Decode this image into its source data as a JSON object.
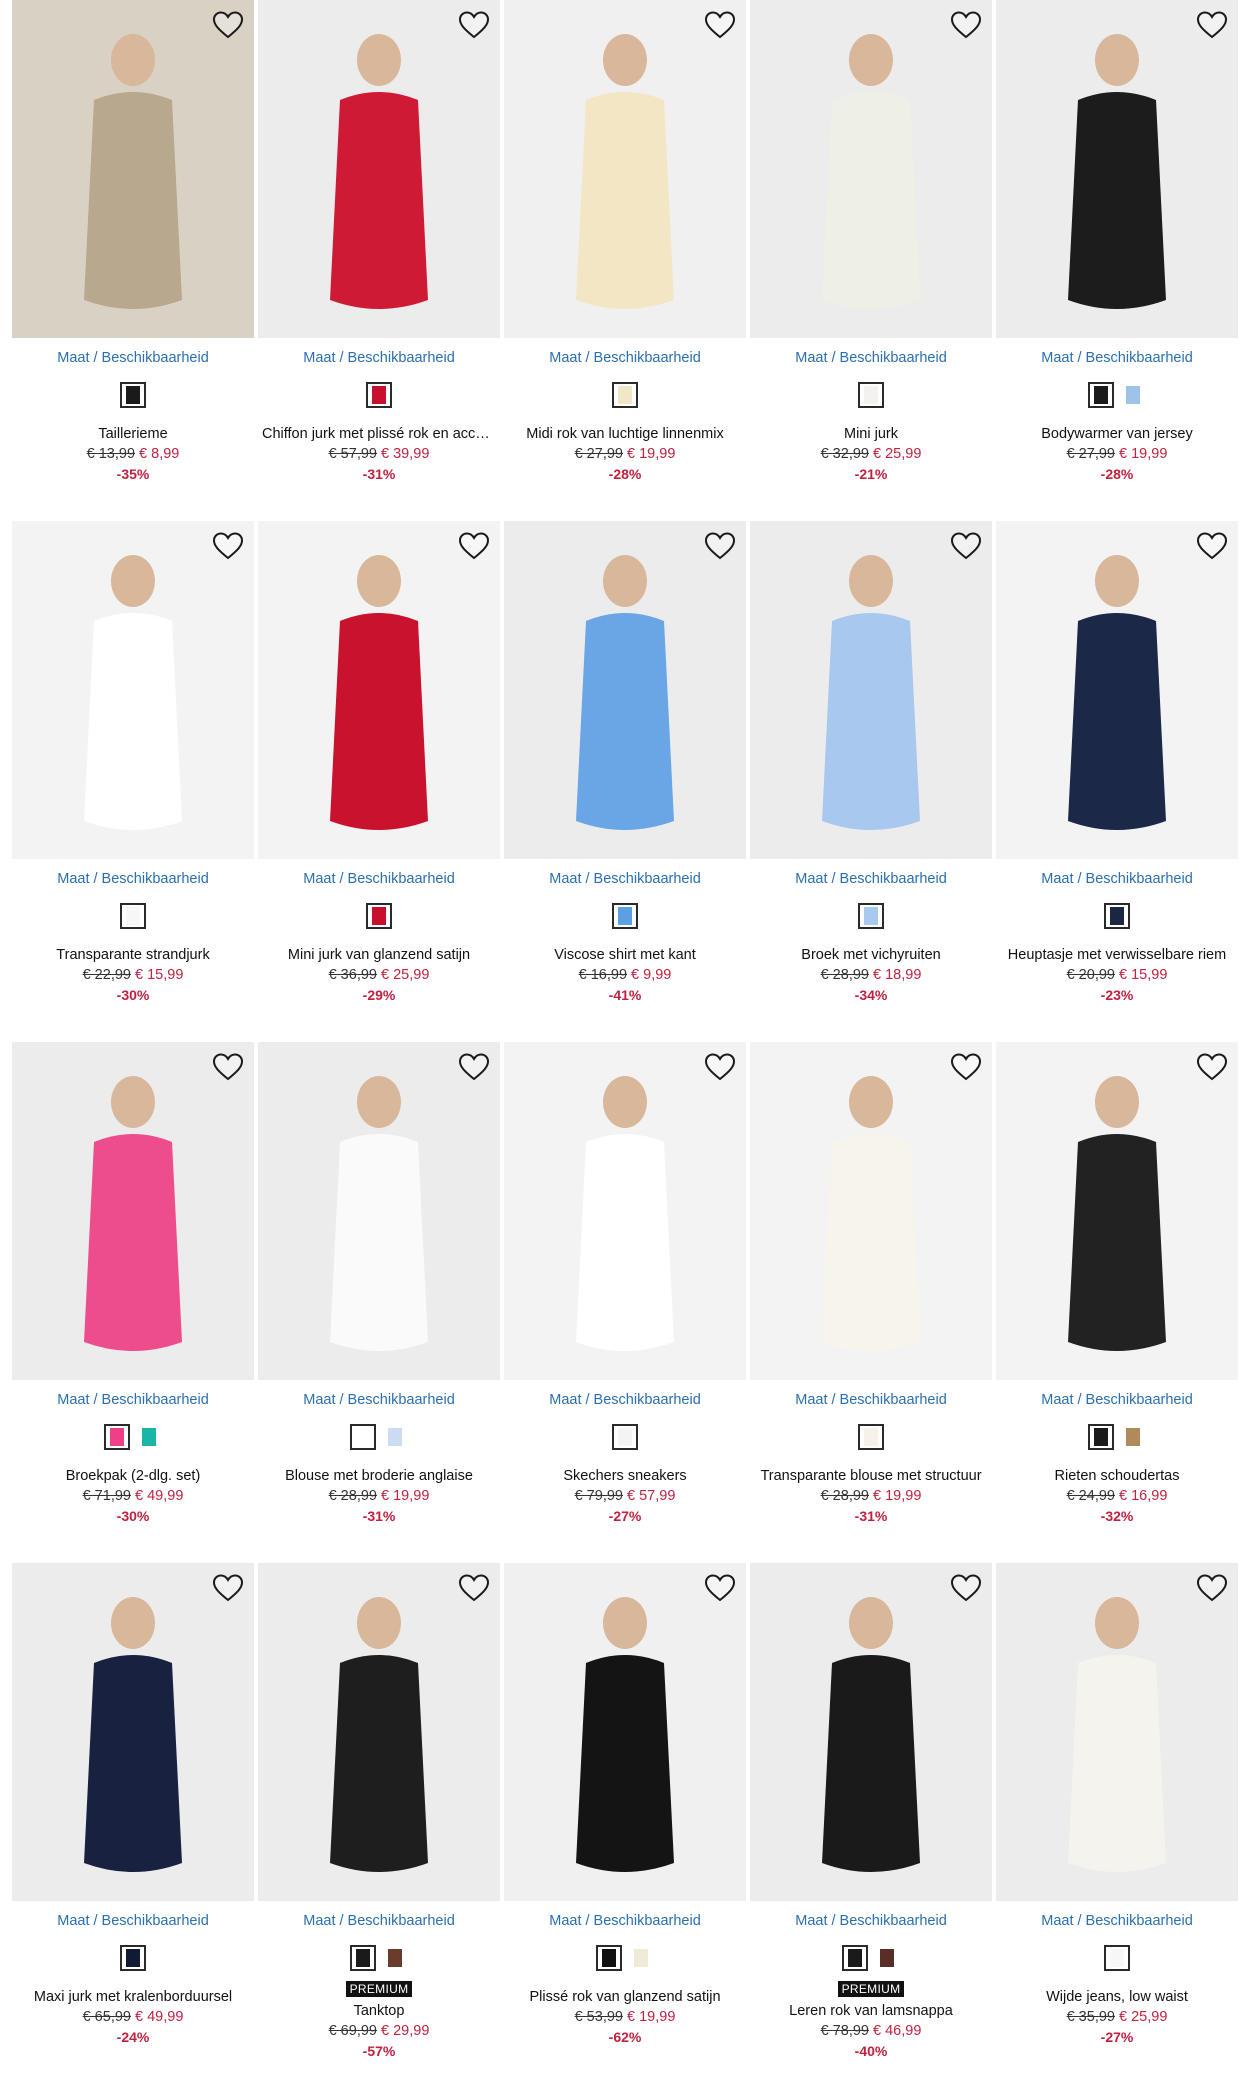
{
  "size_link_label": "Maat / Beschikbaarheid",
  "products": [
    {
      "name": "Taillerieme",
      "old": "€ 13,99",
      "new": "€ 8,99",
      "disc": "-35%",
      "swatches": [
        "#1a1a1a"
      ],
      "premium": "",
      "bg": "#d9d2c4",
      "fig": "#b7a88e"
    },
    {
      "name": "Chiffon jurk met plissé rok en acce…",
      "old": "€ 57,99",
      "new": "€ 39,99",
      "disc": "-31%",
      "swatches": [
        "#c8102e"
      ],
      "premium": "",
      "bg": "#ececec",
      "fig": "#cf1a36"
    },
    {
      "name": "Midi rok van luchtige linnenmix",
      "old": "€ 27,99",
      "new": "€ 19,99",
      "disc": "-28%",
      "swatches": [
        "#f1e6c6"
      ],
      "premium": "",
      "bg": "#f0f0f0",
      "fig": "#f2e6c4"
    },
    {
      "name": "Mini jurk",
      "old": "€ 32,99",
      "new": "€ 25,99",
      "disc": "-21%",
      "swatches": [
        "#f4f2ee"
      ],
      "premium": "",
      "bg": "#ececec",
      "fig": "#eef0e6"
    },
    {
      "name": "Bodywarmer van jersey",
      "old": "€ 27,99",
      "new": "€ 19,99",
      "disc": "-28%",
      "swatches": [
        "#1a1a1a",
        "#9ec3ea"
      ],
      "premium": "",
      "bg": "#ececec",
      "fig": "#1c1c1c"
    },
    {
      "name": "Transparante strandjurk",
      "old": "€ 22,99",
      "new": "€ 15,99",
      "disc": "-30%",
      "swatches": [
        "#f7f7f7"
      ],
      "premium": "",
      "bg": "#f3f3f3",
      "fig": "#ffffff"
    },
    {
      "name": "Mini jurk van glanzend satijn",
      "old": "€ 36,99",
      "new": "€ 25,99",
      "disc": "-29%",
      "swatches": [
        "#c8102e"
      ],
      "premium": "",
      "bg": "#f3f3f3",
      "fig": "#c8122e"
    },
    {
      "name": "Viscose shirt met kant",
      "old": "€ 16,99",
      "new": "€ 9,99",
      "disc": "-41%",
      "swatches": [
        "#5c9fe3"
      ],
      "premium": "",
      "bg": "#ececec",
      "fig": "#6aa6e6"
    },
    {
      "name": "Broek met vichyruiten",
      "old": "€ 28,99",
      "new": "€ 18,99",
      "disc": "-34%",
      "swatches": [
        "#a9c9ef"
      ],
      "premium": "",
      "bg": "#ececec",
      "fig": "#a8c8ef"
    },
    {
      "name": "Heuptasje met verwisselbare riem",
      "old": "€ 20,99",
      "new": "€ 15,99",
      "disc": "-23%",
      "swatches": [
        "#1a2642"
      ],
      "premium": "",
      "bg": "#f3f3f3",
      "fig": "#1b2848"
    },
    {
      "name": "Broekpak (2-dlg. set)",
      "old": "€ 71,99",
      "new": "€ 49,99",
      "disc": "-30%",
      "swatches": [
        "#ef3f88",
        "#19b5a5"
      ],
      "premium": "",
      "bg": "#ececec",
      "fig": "#ee4d8c"
    },
    {
      "name": "Blouse met broderie anglaise",
      "old": "€ 28,99",
      "new": "€ 19,99",
      "disc": "-31%",
      "swatches": [
        "#ffffff",
        "#c9dcf2"
      ],
      "premium": "",
      "bg": "#ececec",
      "fig": "#fafafa"
    },
    {
      "name": "Skechers sneakers",
      "old": "€ 79,99",
      "new": "€ 57,99",
      "disc": "-27%",
      "swatches": [
        "#f4f4f4"
      ],
      "premium": "",
      "bg": "#f3f3f3",
      "fig": "#ffffff"
    },
    {
      "name": "Transparante blouse met structuur",
      "old": "€ 28,99",
      "new": "€ 19,99",
      "disc": "-31%",
      "swatches": [
        "#f6f2ea"
      ],
      "premium": "",
      "bg": "#f3f3f3",
      "fig": "#f7f4ec"
    },
    {
      "name": "Rieten schoudertas",
      "old": "€ 24,99",
      "new": "€ 16,99",
      "disc": "-32%",
      "swatches": [
        "#1a1a1a",
        "#b08a5a"
      ],
      "premium": "",
      "bg": "#f3f3f3",
      "fig": "#222222"
    },
    {
      "name": "Maxi jurk met kralenborduursel",
      "old": "€ 65,99",
      "new": "€ 49,99",
      "disc": "-24%",
      "swatches": [
        "#111a33"
      ],
      "premium": "",
      "bg": "#ececec",
      "fig": "#182140"
    },
    {
      "name": "Tanktop",
      "old": "€ 69,99",
      "new": "€ 29,99",
      "disc": "-57%",
      "swatches": [
        "#1a1a1a",
        "#6b3b2e"
      ],
      "premium": "PREMIUM",
      "bg": "#ececec",
      "fig": "#1e1e1e"
    },
    {
      "name": "Plissé rok van glanzend satijn",
      "old": "€ 53,99",
      "new": "€ 19,99",
      "disc": "-62%",
      "swatches": [
        "#111111",
        "#f1ead8"
      ],
      "premium": "",
      "bg": "#f0f0f0",
      "fig": "#141414"
    },
    {
      "name": "Leren rok van lamsnappa",
      "old": "€ 78,99",
      "new": "€ 46,99",
      "disc": "-40%",
      "swatches": [
        "#1a1a1a",
        "#5a2e25"
      ],
      "premium": "PREMIUM",
      "bg": "#ececec",
      "fig": "#1a1a1a"
    },
    {
      "name": "Wijde jeans, low waist",
      "old": "€ 35,99",
      "new": "€ 25,99",
      "disc": "-27%",
      "swatches": [
        "#f7f7f7"
      ],
      "premium": "",
      "bg": "#ececec",
      "fig": "#f5f3ee"
    }
  ]
}
